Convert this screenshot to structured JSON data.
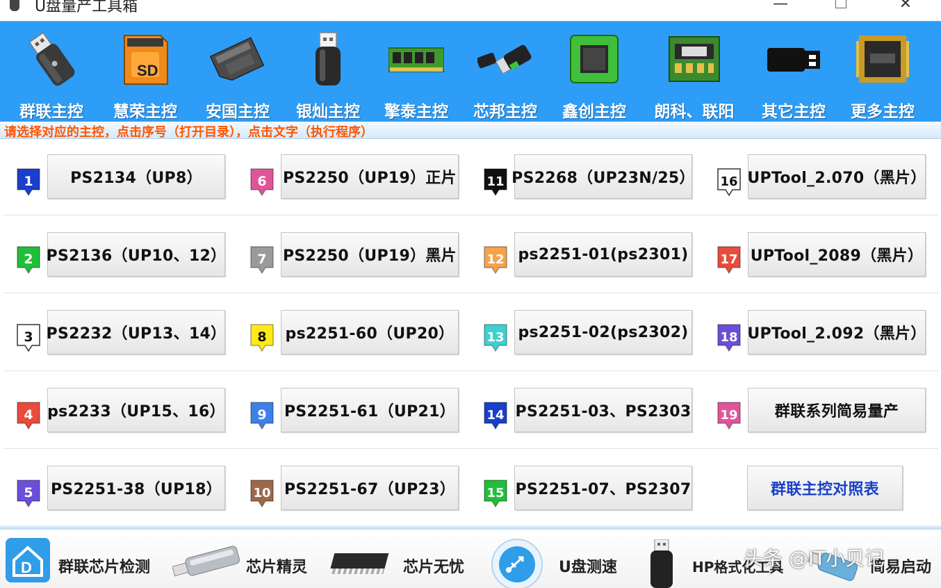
{
  "window": {
    "title": "U盘量产工具箱",
    "min_glyph": "—",
    "close_glyph": "✕"
  },
  "toolbar": [
    {
      "label": "群联主控",
      "icon": "usb-drive-icon"
    },
    {
      "label": "慧荣主控",
      "icon": "sd-card-icon"
    },
    {
      "label": "安国主控",
      "icon": "micro-sd-card-icon"
    },
    {
      "label": "银灿主控",
      "icon": "usb-stick-icon"
    },
    {
      "label": "擎泰主控",
      "icon": "memory-module-icon"
    },
    {
      "label": "芯邦主控",
      "icon": "usb-flash-green-icon"
    },
    {
      "label": "鑫创主控",
      "icon": "chip-icon"
    },
    {
      "label": "朗科、联阳",
      "icon": "circuit-board-icon"
    },
    {
      "label": "其它主控",
      "icon": "usb-plug-icon"
    },
    {
      "label": "更多主控",
      "icon": "processor-icon"
    }
  ],
  "hint": "请选择对应的主控，点击序号（打开目录），点击文字（执行程序）",
  "tools": [
    {
      "num": "1",
      "label": "PS2134（UP8）",
      "color": "#1a3fcc",
      "text": "#ffffff"
    },
    {
      "num": "2",
      "label": "PS2136（UP10、12）",
      "color": "#1fbf3a",
      "text": "#ffffff"
    },
    {
      "num": "3",
      "label": "PS2232（UP13、14）",
      "color": "#ffffff",
      "text": "#111111"
    },
    {
      "num": "4",
      "label": "ps2233（UP15、16）",
      "color": "#e94b3c",
      "text": "#ffffff"
    },
    {
      "num": "5",
      "label": "PS2251-38（UP18）",
      "color": "#6b4fd8",
      "text": "#ffffff"
    },
    {
      "num": "6",
      "label": "PS2250（UP19）正片",
      "color": "#e0559a",
      "text": "#ffffff"
    },
    {
      "num": "7",
      "label": "PS2250（UP19）黑片",
      "color": "#9a9a9a",
      "text": "#ffffff"
    },
    {
      "num": "8",
      "label": "ps2251-60（UP20）",
      "color": "#ffe81a",
      "text": "#111111"
    },
    {
      "num": "9",
      "label": "PS2251-61（UP21）",
      "color": "#3f7fe8",
      "text": "#ffffff"
    },
    {
      "num": "10",
      "label": "PS2251-67（UP23）",
      "color": "#9c6a4a",
      "text": "#ffffff"
    },
    {
      "num": "11",
      "label": "PS2268（UP23N/25）",
      "color": "#111111",
      "text": "#ffffff"
    },
    {
      "num": "12",
      "label": "ps2251-01(ps2301)",
      "color": "#f5a24a",
      "text": "#ffffff"
    },
    {
      "num": "13",
      "label": "ps2251-02(ps2302)",
      "color": "#3fd0d0",
      "text": "#ffffff"
    },
    {
      "num": "14",
      "label": "PS2251-03、PS2303",
      "color": "#1a3fcc",
      "text": "#ffffff"
    },
    {
      "num": "15",
      "label": "PS2251-07、PS2307",
      "color": "#1fbf3a",
      "text": "#ffffff"
    },
    {
      "num": "16",
      "label": "UPTool_2.070（黑片）",
      "color": "#ffffff",
      "text": "#111111"
    },
    {
      "num": "17",
      "label": "UPTool_2089（黑片）",
      "color": "#e94b3c",
      "text": "#ffffff"
    },
    {
      "num": "18",
      "label": "UPTool_2.092（黑片）",
      "color": "#6b4fd8",
      "text": "#ffffff"
    },
    {
      "num": "19",
      "label": "群联系列简易量产",
      "color": "#e0559a",
      "text": "#ffffff"
    }
  ],
  "reference_button": "群联主控对照表",
  "bottom": [
    {
      "label": "群联芯片检测",
      "icon": "home-d-icon"
    },
    {
      "label": "芯片精灵",
      "icon": "usb-silver-icon"
    },
    {
      "label": "芯片无忧",
      "icon": "ic-chip-icon"
    },
    {
      "label": "U盘测速",
      "icon": "usb-circle-icon"
    },
    {
      "label": "HP格式化工具",
      "icon": "usb-black-icon"
    },
    {
      "label": "简易启动",
      "icon": "usb-blue-icon"
    }
  ],
  "watermark": "头条 @IT小贝记"
}
